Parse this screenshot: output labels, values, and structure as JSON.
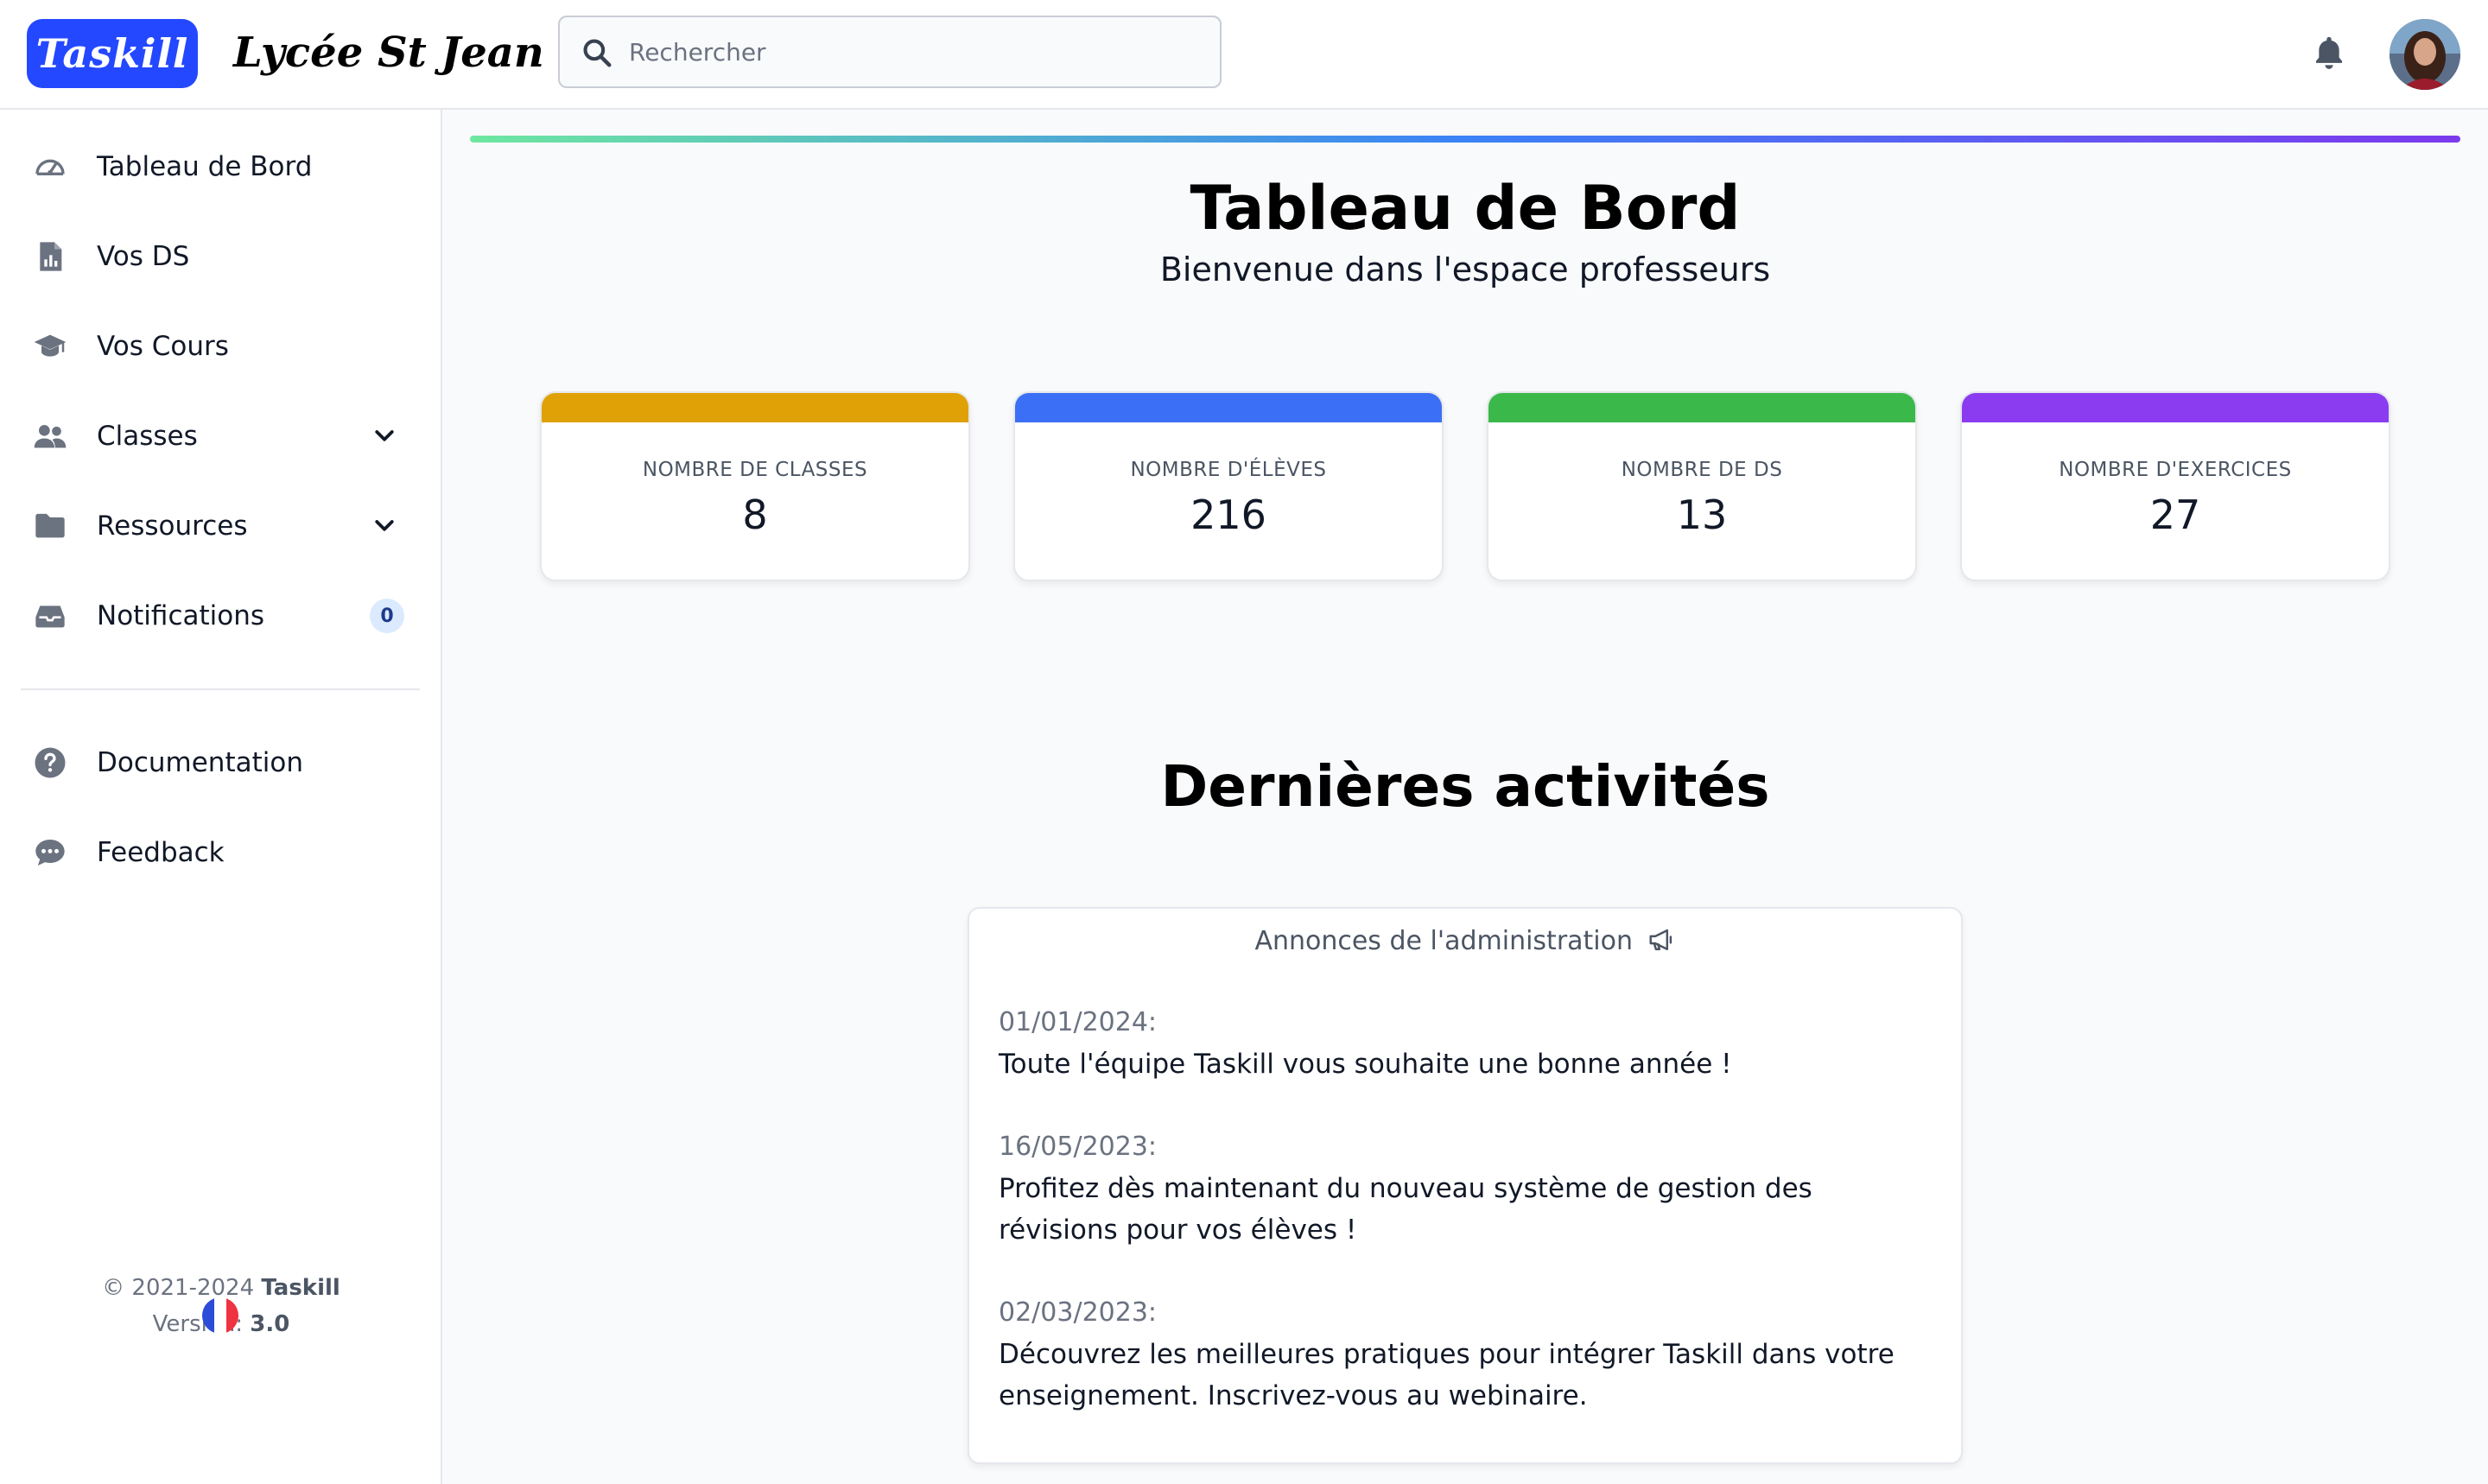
{
  "header": {
    "logo": "Taskill",
    "school": "Lycée St Jean",
    "search_placeholder": "Rechercher"
  },
  "sidebar": {
    "items": [
      {
        "label": "Tableau de Bord",
        "icon": "gauge-icon"
      },
      {
        "label": "Vos DS",
        "icon": "file-chart-icon"
      },
      {
        "label": "Vos Cours",
        "icon": "graduation-cap-icon"
      },
      {
        "label": "Classes",
        "icon": "users-icon"
      },
      {
        "label": "Ressources",
        "icon": "folder-icon"
      },
      {
        "label": "Notifications",
        "icon": "inbox-icon",
        "badge": "0"
      }
    ],
    "secondary": [
      {
        "label": "Documentation",
        "icon": "question-circle-icon"
      },
      {
        "label": "Feedback",
        "icon": "comment-dots-icon"
      }
    ],
    "footer": {
      "copyright": "2021-2024",
      "brand": "Taskill",
      "version_label": "Version:",
      "version": "3.0"
    }
  },
  "main": {
    "title": "Tableau de Bord",
    "subtitle": "Bienvenue dans l'espace professeurs",
    "stats": [
      {
        "label": "NOMBRE DE CLASSES",
        "value": "8",
        "color": "#e0a106"
      },
      {
        "label": "NOMBRE D'ÉLÈVES",
        "value": "216",
        "color": "#3b6ff5"
      },
      {
        "label": "NOMBRE DE DS",
        "value": "13",
        "color": "#3bb84a"
      },
      {
        "label": "NOMBRE D'EXERCICES",
        "value": "27",
        "color": "#8b3cf0"
      }
    ],
    "section_title": "Dernières activités",
    "announcements": {
      "heading": "Annonces de l'administration",
      "entries": [
        {
          "date": "01/01/2024:",
          "text": "Toute l'équipe Taskill vous souhaite une bonne année !"
        },
        {
          "date": "16/05/2023:",
          "text": "Profitez dès maintenant du nouveau système de gestion des révisions pour vos élèves !"
        },
        {
          "date": "02/03/2023:",
          "text": "Découvrez les meilleures pratiques pour intégrer Taskill dans votre enseignement. Inscrivez-vous au webinaire."
        }
      ]
    }
  },
  "colors": {
    "brand": "#2448ff",
    "gradient_start": "#6ee7a0",
    "gradient_mid": "#3b82f6",
    "gradient_end": "#7c3aed"
  }
}
